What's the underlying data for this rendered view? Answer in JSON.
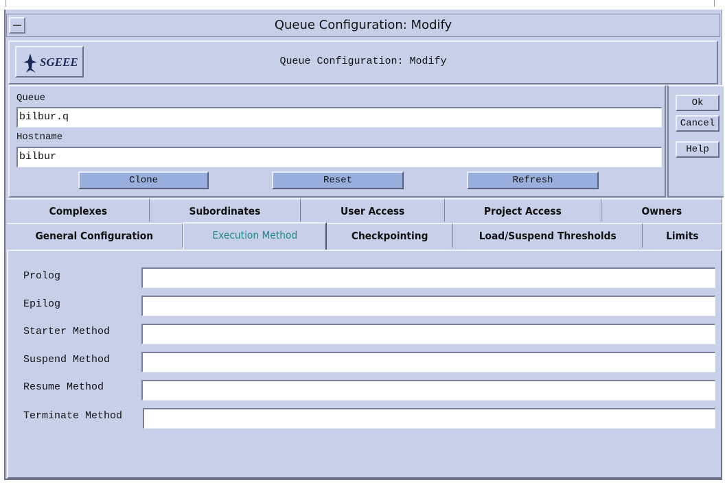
{
  "window": {
    "title": "Queue Configuration: Modify"
  },
  "header": {
    "logo_text": "SGEEE",
    "title": "Queue Configuration: Modify"
  },
  "form": {
    "queue_label": "Queue",
    "queue_value": "bilbur.q",
    "hostname_label": "Hostname",
    "hostname_value": "bilbur",
    "clone_label": "Clone",
    "reset_label": "Reset",
    "refresh_label": "Refresh"
  },
  "side_buttons": {
    "ok": "Ok",
    "cancel": "Cancel",
    "help": "Help"
  },
  "tabs_row1": [
    "Complexes",
    "Subordinates",
    "User Access",
    "Project Access",
    "Owners"
  ],
  "tabs_row2": [
    "General Configuration",
    "Execution Method",
    "Checkpointing",
    "Load/Suspend Thresholds",
    "Limits"
  ],
  "active_tab": "Execution Method",
  "execution": {
    "prolog": "Prolog",
    "epilog": "Epilog",
    "starter": "Starter Method",
    "suspend": "Suspend Method",
    "resume": "Resume Method",
    "terminate": "Terminate Method"
  },
  "colors": {
    "background": "#c7d0e8",
    "button": "#98aedc",
    "active_tab_text": "#1f8a8a"
  }
}
